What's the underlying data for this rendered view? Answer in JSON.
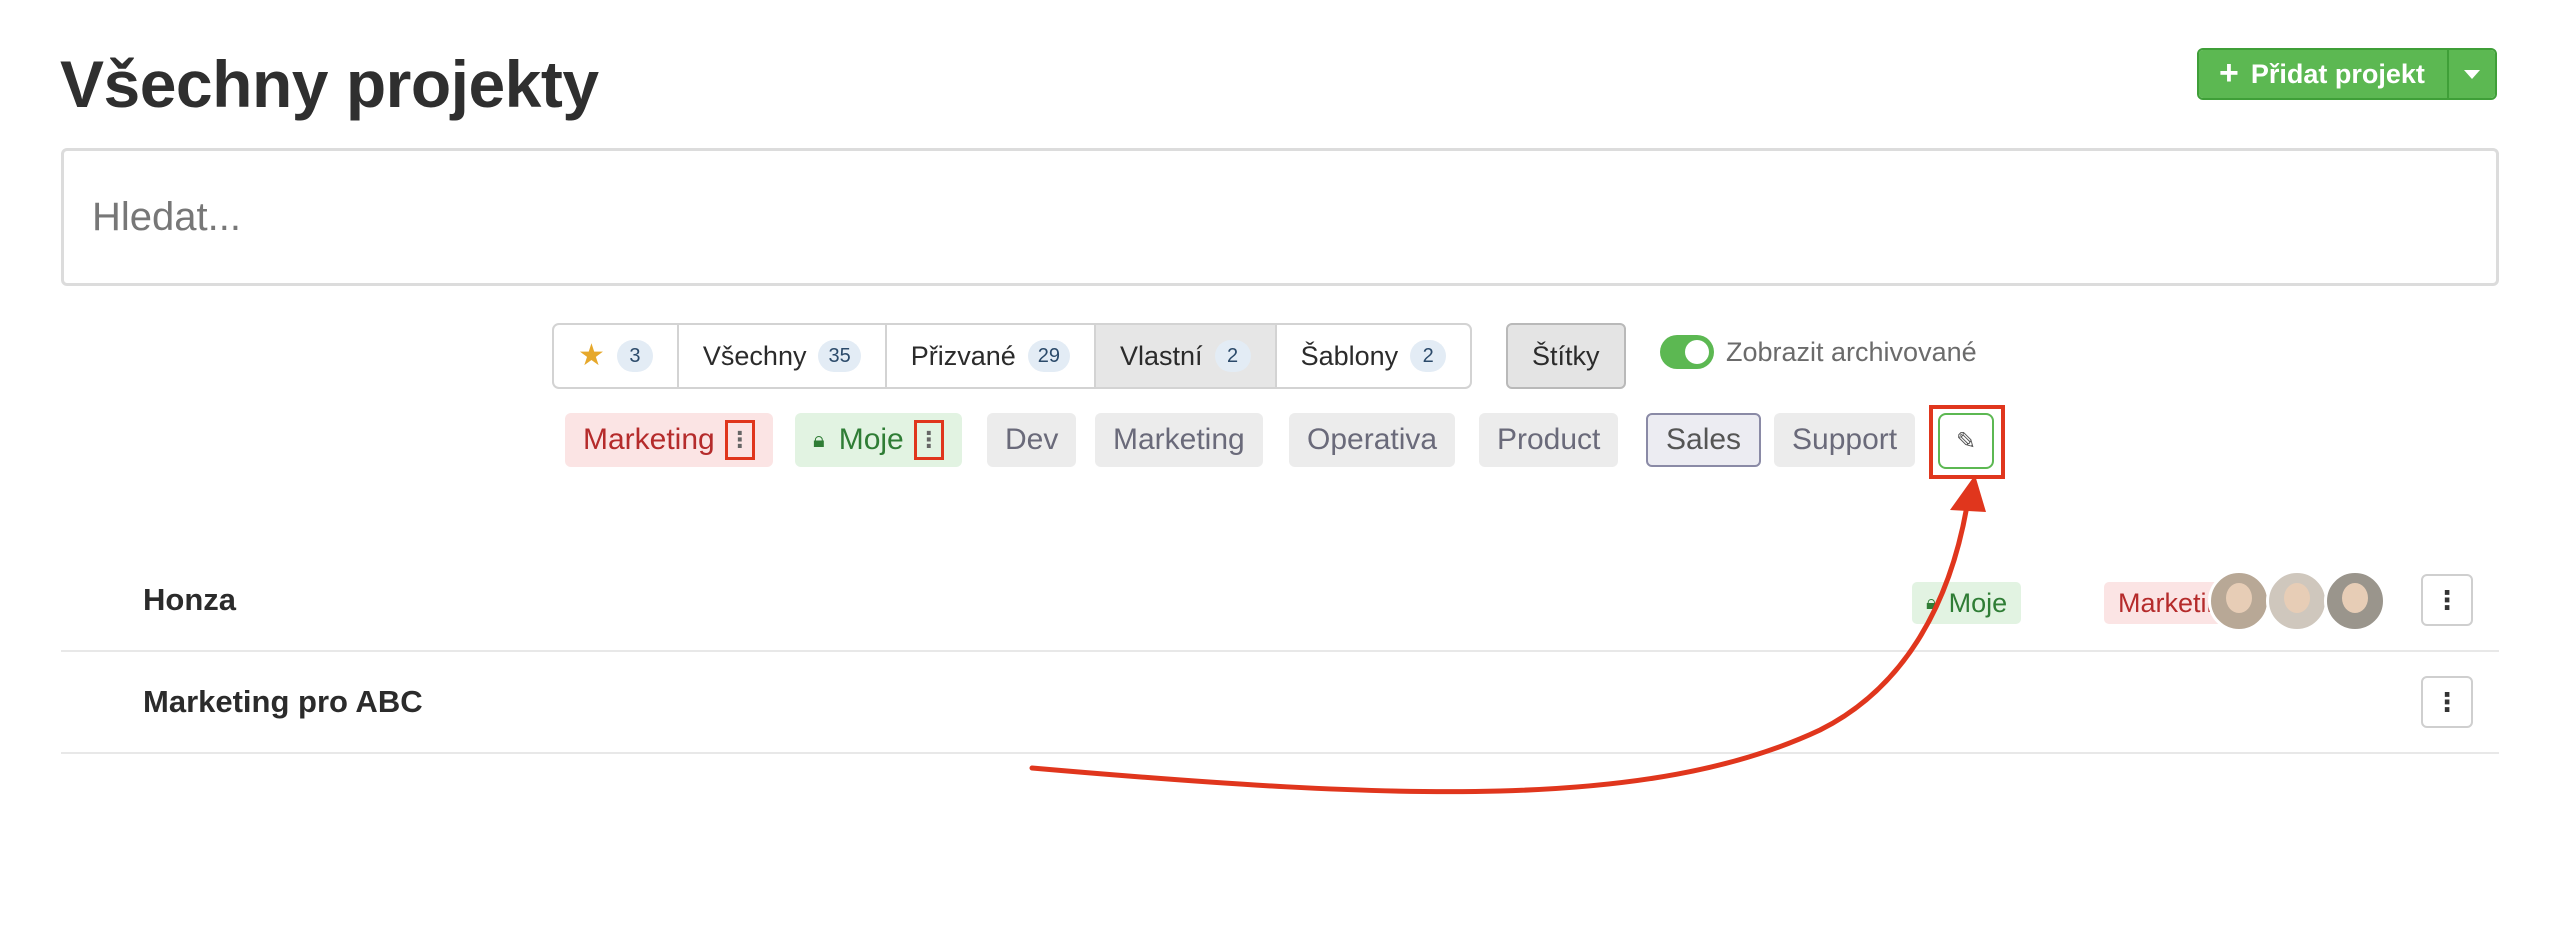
{
  "page": {
    "title": "Všechny projekty"
  },
  "header": {
    "add_label": "Přidat projekt"
  },
  "search": {
    "placeholder": "Hledat..."
  },
  "filters": {
    "tabs": [
      {
        "label": "",
        "icon": "star-icon",
        "count": "3"
      },
      {
        "label": "Všechny",
        "count": "35"
      },
      {
        "label": "Přizvané",
        "count": "29"
      },
      {
        "label": "Vlastní",
        "count": "2",
        "active": true
      },
      {
        "label": "Šablony",
        "count": "2"
      }
    ],
    "tags_label": "Štítky",
    "archive_label": "Zobrazit archivované",
    "archive_on": true
  },
  "tags": {
    "marketing_red": "Marketing",
    "moje": "Moje",
    "dev": "Dev",
    "marketing": "Marketing",
    "operativa": "Operativa",
    "product": "Product",
    "sales": "Sales",
    "support": "Support"
  },
  "projects": [
    {
      "name": "Honza",
      "tags": [
        "Moje",
        "Marketing"
      ]
    },
    {
      "name": "Marketing pro ABC",
      "tags": []
    }
  ],
  "colors": {
    "accent": "#5cb852",
    "highlight": "#e0361d",
    "tag_red": "#b52b2b",
    "tag_green": "#2f7d35"
  }
}
